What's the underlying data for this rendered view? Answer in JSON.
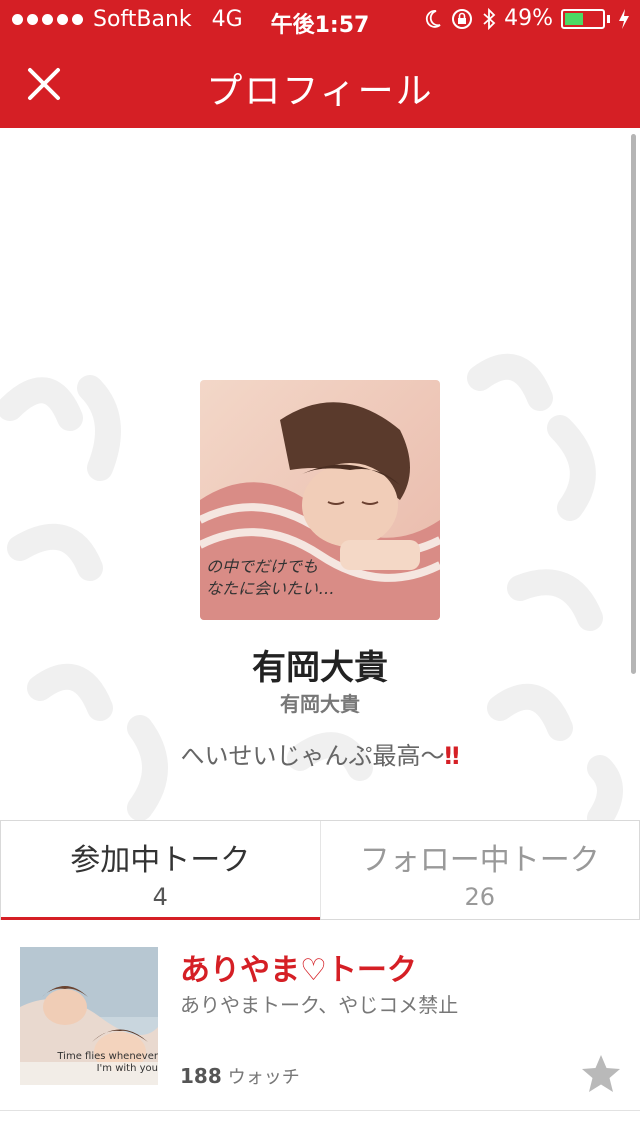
{
  "status_bar": {
    "carrier": "SoftBank",
    "network": "4G",
    "time": "午後1:57",
    "battery_percent": "49%",
    "battery_level": 0.49,
    "battery_color": "#4cd964",
    "icons": [
      "signal-dots-icon",
      "moon-icon",
      "rotation-lock-icon",
      "bluetooth-icon",
      "battery-icon",
      "charging-icon"
    ]
  },
  "nav": {
    "title": "プロフィール",
    "close_icon": "close-icon",
    "color": "#d51f25"
  },
  "profile": {
    "name": "有岡大貴",
    "username": "有岡大貴",
    "bio": "へいせいじゃんぷ最高〜",
    "bio_emoji": "‼",
    "avatar_caption_line1": "の中でだけでも",
    "avatar_caption_line2": "なたに会いたい…"
  },
  "tabs": [
    {
      "label": "参加中トーク",
      "count": "4",
      "active": true
    },
    {
      "label": "フォロー中トーク",
      "count": "26",
      "active": false
    }
  ],
  "talks": [
    {
      "title": "ありやま♡トーク",
      "description": "ありやまトーク、やじコメ禁止",
      "watch_count": "188",
      "watch_label": "ウォッチ",
      "thumb_text": "Time flies whenever I'm with you",
      "star_icon": "star-icon"
    }
  ]
}
